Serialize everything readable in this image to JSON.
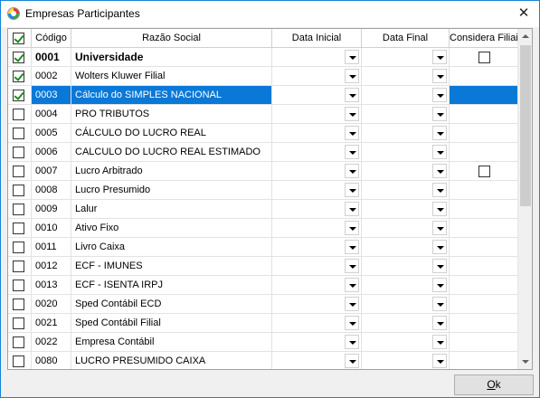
{
  "window": {
    "title": "Empresas Participantes",
    "close_glyph": "✕"
  },
  "columns": {
    "code": "Código",
    "razao": "Razão Social",
    "data_inicial": "Data Inicial",
    "data_final": "Data Final",
    "considera_filiais": "Considera Filiais"
  },
  "header_checkbox_checked": true,
  "rows": [
    {
      "checked": true,
      "code": "0001",
      "name": "Universidade",
      "bold": true,
      "filial_checkbox": true,
      "filial_checked": false
    },
    {
      "checked": true,
      "code": "0002",
      "name": "Wolters Kluwer Filial",
      "bold": false,
      "filial_checkbox": false
    },
    {
      "checked": true,
      "code": "0003",
      "name": "Cálculo do SIMPLES NACIONAL",
      "bold": false,
      "selected": true,
      "filial_checkbox": false
    },
    {
      "checked": false,
      "code": "0004",
      "name": "PRO TRIBUTOS",
      "bold": false,
      "filial_checkbox": false
    },
    {
      "checked": false,
      "code": "0005",
      "name": "CÁLCULO DO LUCRO REAL",
      "bold": false,
      "filial_checkbox": false
    },
    {
      "checked": false,
      "code": "0006",
      "name": "CALCULO DO LUCRO REAL ESTIMADO",
      "bold": false,
      "filial_checkbox": false
    },
    {
      "checked": false,
      "code": "0007",
      "name": "Lucro Arbitrado",
      "bold": false,
      "filial_checkbox": true,
      "filial_checked": false
    },
    {
      "checked": false,
      "code": "0008",
      "name": "Lucro Presumido",
      "bold": false,
      "filial_checkbox": false
    },
    {
      "checked": false,
      "code": "0009",
      "name": "Lalur",
      "bold": false,
      "filial_checkbox": false
    },
    {
      "checked": false,
      "code": "0010",
      "name": "Ativo Fixo",
      "bold": false,
      "filial_checkbox": false
    },
    {
      "checked": false,
      "code": "0011",
      "name": "Livro Caixa",
      "bold": false,
      "filial_checkbox": false
    },
    {
      "checked": false,
      "code": "0012",
      "name": "ECF - IMUNES",
      "bold": false,
      "filial_checkbox": false
    },
    {
      "checked": false,
      "code": "0013",
      "name": "ECF - ISENTA IRPJ",
      "bold": false,
      "filial_checkbox": false
    },
    {
      "checked": false,
      "code": "0020",
      "name": "Sped Contábil ECD",
      "bold": false,
      "filial_checkbox": false
    },
    {
      "checked": false,
      "code": "0021",
      "name": "Sped Contábil Filial",
      "bold": false,
      "filial_checkbox": false
    },
    {
      "checked": false,
      "code": "0022",
      "name": "Empresa Contábil",
      "bold": false,
      "filial_checkbox": false
    },
    {
      "checked": false,
      "code": "0080",
      "name": "LUCRO PRESUMIDO CAIXA",
      "bold": false,
      "filial_checkbox": false
    }
  ],
  "ok_button": {
    "label_underlined": "O",
    "label_rest": "k"
  },
  "colors": {
    "selection": "#0a78d7",
    "window_border": "#1883d7",
    "check": "#1f8a1f"
  }
}
